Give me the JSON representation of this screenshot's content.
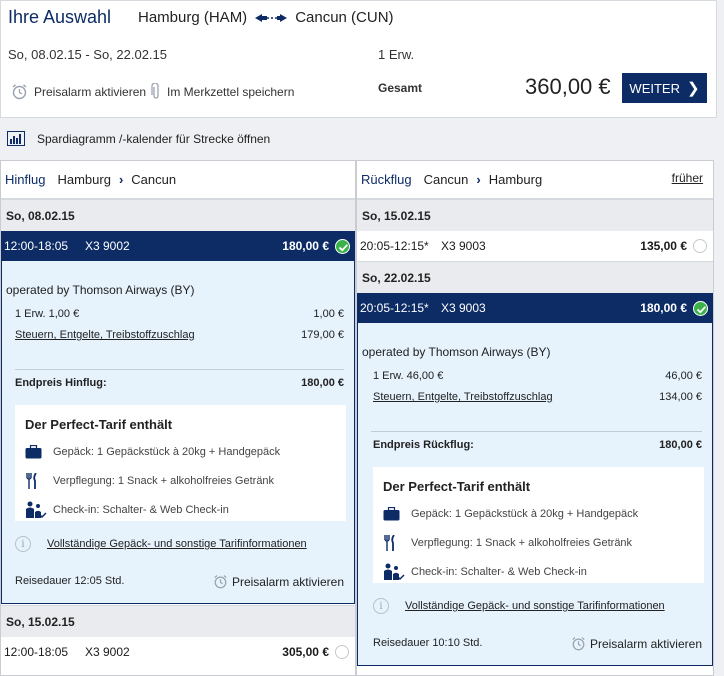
{
  "summary": {
    "title": "Ihre Auswahl",
    "from": "Hamburg (HAM)",
    "to": "Cancun (CUN)",
    "dates": "So, 08.02.15 - So, 22.02.15",
    "passengers": "1 Erw.",
    "price_alert": "Preisalarm aktivieren",
    "save_watchlist": "Im Merkzettel speichern",
    "total_label": "Gesamt",
    "total_value": "360,00 €",
    "continue_label": "WEITER"
  },
  "savings_diagram": "Spardiagramm /-kalender für Strecke öffnen",
  "outbound": {
    "direction": "Hinflug",
    "from": "Hamburg",
    "to": "Cancun",
    "date1": "So, 08.02.15",
    "flight1": {
      "time": "12:00-18:05",
      "number": "X3 9002",
      "price": "180,00 €"
    },
    "operated_by": "operated by Thomson Airways (BY)",
    "fare_label": "1 Erw.  1,00  €",
    "fare_value": "1,00 €",
    "taxes_label": "Steuern, Entgelte, Treibstoffzuschlag",
    "taxes_value": "179,00 €",
    "end_label": "Endpreis Hinflug:",
    "end_value": "180,00 €",
    "tarif_title": "Der Perfect-Tarif enthält",
    "baggage": "Gepäck: 1 Gepäckstück à 20kg + Handgepäck",
    "meals": "Verpflegung: 1 Snack + alkoholfreies Getränk",
    "checkin": "Check-in: Schalter- & Web Check-in",
    "full_info": "Vollständige Gepäck- und sonstige Tarifinformationen",
    "duration": "Reisedauer 12:05  Std.",
    "price_alert": "Preisalarm aktivieren",
    "date2": "So, 15.02.15",
    "flight2": {
      "time": "12:00-18:05",
      "number": "X3 9002",
      "price": "305,00 €"
    }
  },
  "inbound": {
    "direction": "Rückflug",
    "from": "Cancun",
    "to": "Hamburg",
    "earlier": "früher",
    "date1": "So, 15.02.15",
    "flight1": {
      "time": "20:05-12:15*",
      "number": "X3 9003",
      "price": "135,00 €"
    },
    "date2": "So, 22.02.15",
    "flight2": {
      "time": "20:05-12:15*",
      "number": "X3 9003",
      "price": "180,00 €"
    },
    "operated_by": "operated by Thomson Airways (BY)",
    "fare_label": "1 Erw.  46,00  €",
    "fare_value": "46,00 €",
    "taxes_label": "Steuern, Entgelte, Treibstoffzuschlag",
    "taxes_value": "134,00 €",
    "end_label": "Endpreis Rückflug:",
    "end_value": "180,00 €",
    "tarif_title": "Der Perfect-Tarif enthält",
    "baggage": "Gepäck: 1 Gepäckstück à 20kg + Handgepäck",
    "meals": "Verpflegung: 1 Snack + alkoholfreies Getränk",
    "checkin": "Check-in: Schalter- & Web Check-in",
    "full_info": "Vollständige Gepäck- und sonstige Tarifinformationen",
    "duration": "Reisedauer 10:10  Std.",
    "price_alert": "Preisalarm aktivieren"
  },
  "colors": {
    "brand": "#0d2c66",
    "selected_bg": "#e6f2fc",
    "check": "#3bb34a"
  }
}
